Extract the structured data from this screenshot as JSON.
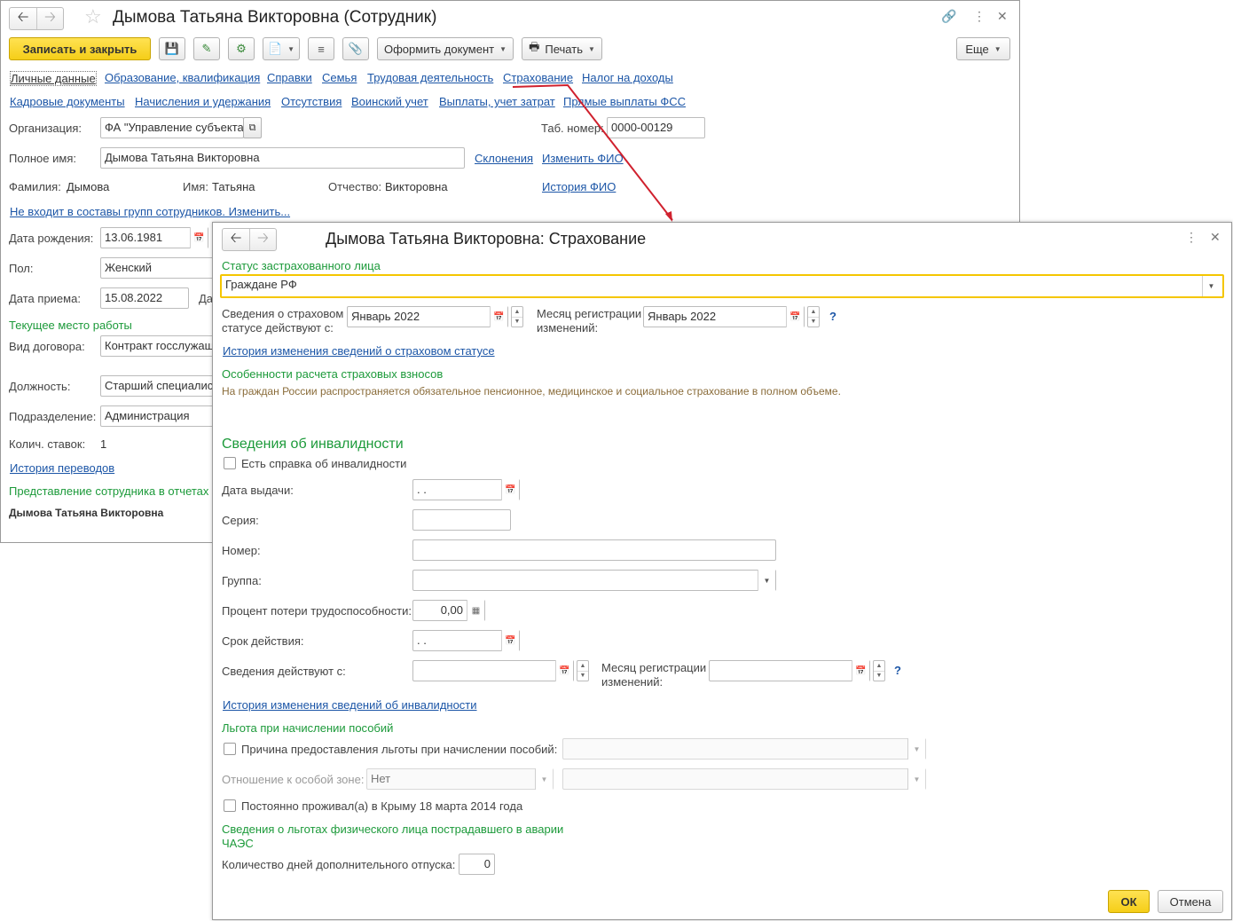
{
  "emp": {
    "title": "Дымова Татьяна Викторовна (Сотрудник)",
    "save_close": "Записать и закрыть",
    "make_doc": "Оформить документ",
    "print": "Печать",
    "more": "Еще",
    "tabs1": [
      "Личные данные",
      "Образование, квалификация",
      "Справки",
      "Семья",
      "Трудовая деятельность",
      "Страхование",
      "Налог на доходы"
    ],
    "tabs2": [
      "Кадровые документы",
      "Начисления и удержания",
      "Отсутствия",
      "Воинский учет",
      "Выплаты, учет затрат",
      "Прямые выплаты ФСС"
    ],
    "org_label": "Организация:",
    "org_value": "ФА \"Управление субъекта",
    "tab_label": "Таб. номер:",
    "tab_value": "0000-00129",
    "fullname_label": "Полное имя:",
    "fullname_value": "Дымова Татьяна Викторовна",
    "declension_link": "Склонения",
    "change_fio_link": "Изменить ФИО",
    "surname_label": "Фамилия:",
    "surname_value": "Дымова",
    "name_label": "Имя:",
    "name_value": "Татьяна",
    "patr_label": "Отчество:",
    "patr_value": "Викторовна",
    "fio_history_link": "История ФИО",
    "groups_link": "Не входит в составы групп сотрудников. Изменить...",
    "birth_label": "Дата рождения:",
    "birth_value": "13.06.1981",
    "sex_label": "Пол:",
    "sex_value": "Женский",
    "hire_label": "Дата приема:",
    "hire_value": "15.08.2022",
    "hire_extra": "Да",
    "workplace_header": "Текущее место работы",
    "contract_label": "Вид договора:",
    "contract_value": "Контракт госслужащ",
    "position_label": "Должность:",
    "position_value": "Старший специалист",
    "dept_label": "Подразделение:",
    "dept_value": "Администрация",
    "rates_label": "Колич. ставок:",
    "rates_value": "1",
    "transfer_link": "История переводов",
    "repr_header": "Представление сотрудника в отчетах",
    "repr_value": "Дымова Татьяна Викторовна"
  },
  "ins": {
    "title": "Дымова Татьяна Викторовна: Страхование",
    "status_header": "Статус застрахованного лица",
    "status_value": "Граждане РФ",
    "valid_from_label_1": "Сведения о страховом",
    "valid_from_label_2": "статусе действуют с:",
    "valid_from_value": "Январь 2022",
    "reg_month_label_1": "Месяц регистрации",
    "reg_month_label_2": "изменений:",
    "reg_month_value": "Январь 2022",
    "help": "?",
    "status_history_link": "История изменения сведений о страховом статусе",
    "calc_header": "Особенности расчета страховых взносов",
    "calc_note": "На граждан России распространяется обязательное пенсионное, медицинское и социальное страхование в полном объеме.",
    "disability_header": "Сведения об инвалидности",
    "has_cert_label": "Есть справка об инвалидности",
    "issue_date_label": "Дата выдачи:",
    "empty_date": " .  .",
    "series_label": "Серия:",
    "number_label": "Номер:",
    "group_label": "Группа:",
    "loss_pct_label": "Процент потери трудоспособности:",
    "loss_pct_value": "0,00",
    "validity_label": "Срок действия:",
    "dis_valid_from_label": "Сведения действуют с:",
    "dis_reg_month_label_1": "Месяц регистрации",
    "dis_reg_month_label_2": "изменений:",
    "dis_history_link": "История изменения сведений об инвалидности",
    "benefit_header": "Льгота при начислении пособий",
    "benefit_reason_label": "Причина предоставления льготы при начислении пособий:",
    "zone_label": "Отношение к особой зоне:",
    "zone_value": "Нет",
    "crimea_label": "Постоянно проживал(а) в Крыму 18 марта 2014 года",
    "chernobyl_header_1": "Сведения о льготах физического лица пострадавшего в аварии",
    "chernobyl_header_2": "ЧАЭС",
    "extra_days_label": "Количество дней дополнительного отпуска:",
    "extra_days_value": "0",
    "ok": "ОК",
    "cancel": "Отмена"
  },
  "colors": {
    "accent_yellow": "#f5ce18",
    "link": "#1c56a7",
    "green": "#1c9a3a",
    "arrow": "#d0212e"
  }
}
